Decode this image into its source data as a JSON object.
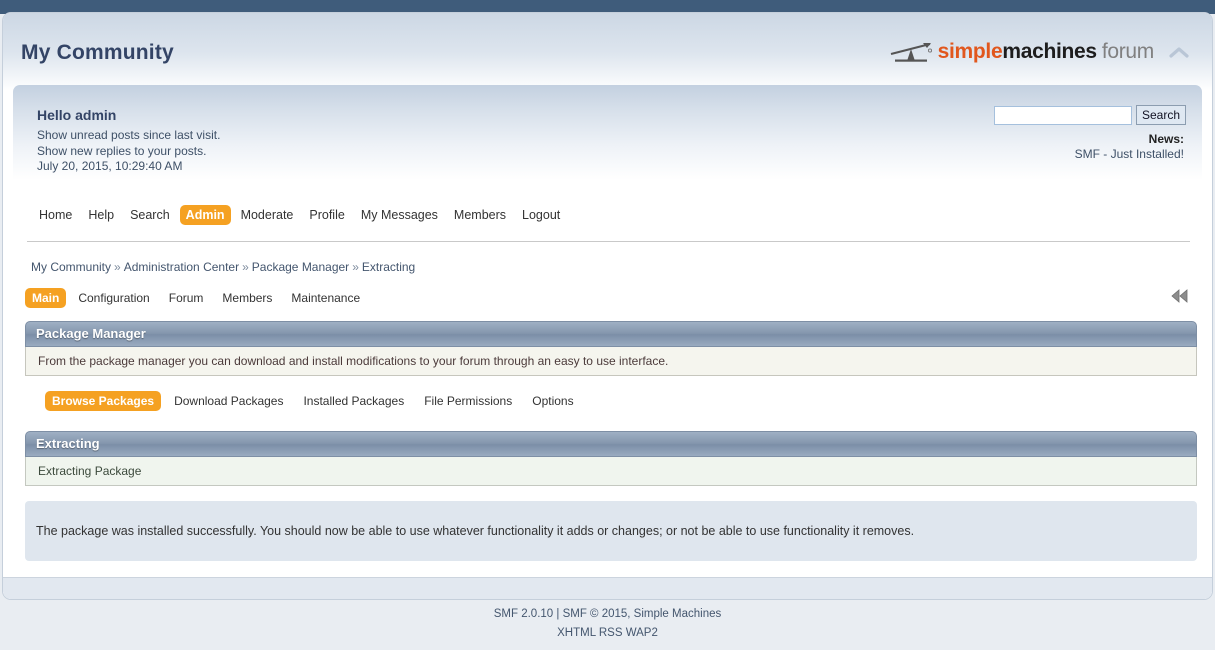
{
  "colors": {
    "top_band": "#3f5c7b",
    "accent_orange": "#f5a122",
    "logo_orange": "#e1571d",
    "title_blue": "#334466",
    "catbar_blue": "#8496ad"
  },
  "header": {
    "site_title": "My Community",
    "logo": {
      "part1": "simple",
      "part2": "machines",
      "part3": "forum",
      "mark_name": "smf-seesaw-logo-icon"
    },
    "collapse_icon": "chevron-up-icon"
  },
  "user_panel": {
    "greeting": "Hello admin",
    "link_unread": "Show unread posts since last visit.",
    "link_replies": "Show new replies to your posts.",
    "datetime": "July 20, 2015, 10:29:40 AM"
  },
  "search": {
    "value": "",
    "placeholder": "",
    "button_label": "Search"
  },
  "news": {
    "label": "News:",
    "text": "SMF - Just Installed!"
  },
  "main_menu": {
    "items": [
      {
        "label": "Home",
        "active": false
      },
      {
        "label": "Help",
        "active": false
      },
      {
        "label": "Search",
        "active": false
      },
      {
        "label": "Admin",
        "active": true
      },
      {
        "label": "Moderate",
        "active": false
      },
      {
        "label": "Profile",
        "active": false
      },
      {
        "label": "My Messages",
        "active": false
      },
      {
        "label": "Members",
        "active": false
      },
      {
        "label": "Logout",
        "active": false
      }
    ]
  },
  "breadcrumb": {
    "separator": "»",
    "items": [
      "My Community",
      "Administration Center",
      "Package Manager",
      "Extracting"
    ]
  },
  "admin_tabs": {
    "items": [
      {
        "label": "Main",
        "active": true
      },
      {
        "label": "Configuration",
        "active": false
      },
      {
        "label": "Forum",
        "active": false
      },
      {
        "label": "Members",
        "active": false
      },
      {
        "label": "Maintenance",
        "active": false
      }
    ],
    "rewind_icon": "double-chevron-left-icon"
  },
  "package_manager": {
    "title": "Package Manager",
    "description": "From the package manager you can download and install modifications to your forum through an easy to use interface.",
    "tabs": [
      {
        "label": "Browse Packages",
        "active": true
      },
      {
        "label": "Download Packages",
        "active": false
      },
      {
        "label": "Installed Packages",
        "active": false
      },
      {
        "label": "File Permissions",
        "active": false
      },
      {
        "label": "Options",
        "active": false
      }
    ]
  },
  "extracting": {
    "title": "Extracting",
    "status": "Extracting Package",
    "result_message": "The package was installed successfully. You should now be able to use whatever functionality it adds or changes; or not be able to use functionality it removes."
  },
  "footer": {
    "line1": "SMF 2.0.10 | SMF © 2015, Simple Machines",
    "line2": "XHTML  RSS  WAP2"
  }
}
